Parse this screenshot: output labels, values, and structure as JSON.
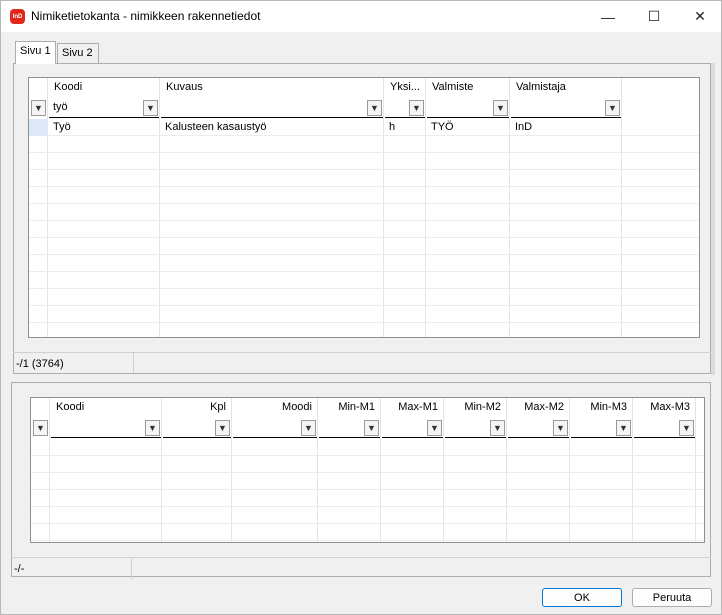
{
  "window": {
    "title": "Nimiketietokanta - nimikkeen rakennetiedot",
    "app_icon_text": "InD",
    "minimize_glyph": "—",
    "maximize_glyph": "☐",
    "close_glyph": "✕"
  },
  "tabs": [
    {
      "label": "Sivu 1",
      "active": true
    },
    {
      "label": "Sivu 2",
      "active": false
    }
  ],
  "grid1": {
    "columns": [
      "Koodi",
      "Kuvaus",
      "Yksi...",
      "Valmiste",
      "Valmistaja"
    ],
    "filters": {
      "koodi": "työ",
      "kuvaus": "",
      "yksikko": "",
      "valmiste": "",
      "valmistaja": ""
    },
    "rows": [
      {
        "koodi": "Työ",
        "kuvaus": "Kalusteen kasaustyö",
        "yksikko": "h",
        "valmiste": "TYÖ",
        "valmistaja": "InD"
      }
    ],
    "status": "-/1 (3764)"
  },
  "grid2": {
    "columns": [
      "Koodi",
      "Kpl",
      "Moodi",
      "Min-M1",
      "Max-M1",
      "Min-M2",
      "Max-M2",
      "Min-M3",
      "Max-M3"
    ],
    "status": "-/-"
  },
  "buttons": {
    "ok": "OK",
    "cancel": "Peruuta"
  },
  "icons": {
    "filter": "filter-icon"
  },
  "colors": {
    "app_icon": "#e2261c",
    "selection": "#dde8f8",
    "ok_border": "#0078d4"
  }
}
